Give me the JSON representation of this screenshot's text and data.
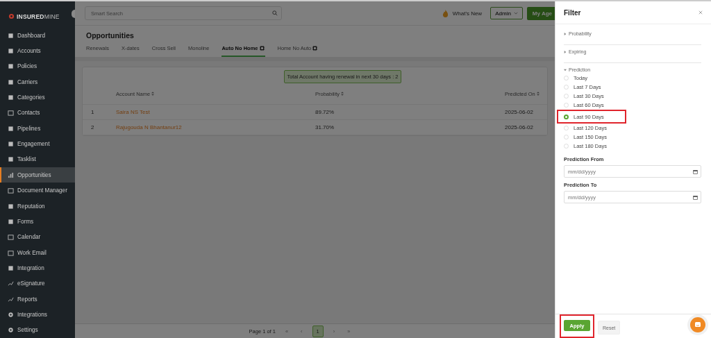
{
  "sidebar": {
    "logo": {
      "bold": "INSURED",
      "light": "MINE"
    },
    "items": [
      {
        "label": "Dashboard",
        "selected": false
      },
      {
        "label": "Accounts",
        "selected": false
      },
      {
        "label": "Policies",
        "selected": false
      },
      {
        "label": "Carriers",
        "selected": false
      },
      {
        "label": "Categories",
        "selected": false
      },
      {
        "label": "Contacts",
        "selected": false
      },
      {
        "label": "Pipelines",
        "selected": false
      },
      {
        "label": "Engagement",
        "selected": false
      },
      {
        "label": "Tasklist",
        "selected": false
      },
      {
        "label": "Opportunities",
        "selected": true
      },
      {
        "label": "Document Manager",
        "selected": false
      },
      {
        "label": "Reputation",
        "selected": false
      },
      {
        "label": "Forms",
        "selected": false
      },
      {
        "label": "Calendar",
        "selected": false
      },
      {
        "label": "Work Email",
        "selected": false
      },
      {
        "label": "Integration",
        "selected": false
      },
      {
        "label": "eSignature",
        "selected": false
      },
      {
        "label": "Reports",
        "selected": false
      },
      {
        "label": "Integrations",
        "selected": false
      },
      {
        "label": "Settings",
        "selected": false
      }
    ]
  },
  "topbar": {
    "search": {
      "placeholder": "Smart Search"
    },
    "whats_new": "What's New",
    "role": "Admin",
    "agency_button": "My Age"
  },
  "page": {
    "title": "Opportunities",
    "tabs": [
      {
        "label": "Renewals",
        "selected": false,
        "ai": false
      },
      {
        "label": "X-dates",
        "selected": false,
        "ai": false
      },
      {
        "label": "Cross Sell",
        "selected": false,
        "ai": false
      },
      {
        "label": "Monoline",
        "selected": false,
        "ai": false
      },
      {
        "label": "Auto No Home",
        "selected": true,
        "ai": true
      },
      {
        "label": "Home No Auto",
        "selected": false,
        "ai": true
      }
    ]
  },
  "notice": "Total Account having renewal in next 30 days : 2",
  "table": {
    "columns": [
      "Account Name",
      "Probability",
      "Predicted On"
    ],
    "rows": [
      {
        "index": "1",
        "name": "Saira NS Test",
        "probability": "89.72%",
        "predicted_on": "2025-06-02"
      },
      {
        "index": "2",
        "name": "Rajugouda N Bhantanur12",
        "probability": "31.70%",
        "predicted_on": "2025-06-02"
      }
    ]
  },
  "pagination": {
    "label": "Page 1 of 1",
    "first": "«",
    "prev": "‹",
    "pages": [
      {
        "label": "1",
        "selected": true
      }
    ],
    "next": "›",
    "last": "»"
  },
  "filter": {
    "title": "Filter",
    "sections": [
      {
        "label": "Probability",
        "expanded": false
      },
      {
        "label": "Expiring",
        "expanded": false
      },
      {
        "label": "Prediction",
        "expanded": true,
        "options": [
          {
            "label": "Today",
            "selected": false,
            "highlighted": false
          },
          {
            "label": "Last 7 Days",
            "selected": false,
            "highlighted": false
          },
          {
            "label": "Last 30 Days",
            "selected": false,
            "highlighted": false
          },
          {
            "label": "Last 60 Days",
            "selected": false,
            "highlighted": false
          },
          {
            "label": "Last 90 Days",
            "selected": true,
            "highlighted": true
          },
          {
            "label": "Last 120 Days",
            "selected": false,
            "highlighted": false
          },
          {
            "label": "Last 150 Days",
            "selected": false,
            "highlighted": false
          },
          {
            "label": "Last 180 Days",
            "selected": false,
            "highlighted": false
          }
        ]
      }
    ],
    "fields": [
      {
        "label": "Prediction From",
        "placeholder": "mm/dd/yyyy"
      },
      {
        "label": "Prediction To",
        "placeholder": "mm/dd/yyyy"
      }
    ],
    "apply": {
      "label": "Apply",
      "highlighted": true
    },
    "reset": "Reset"
  }
}
